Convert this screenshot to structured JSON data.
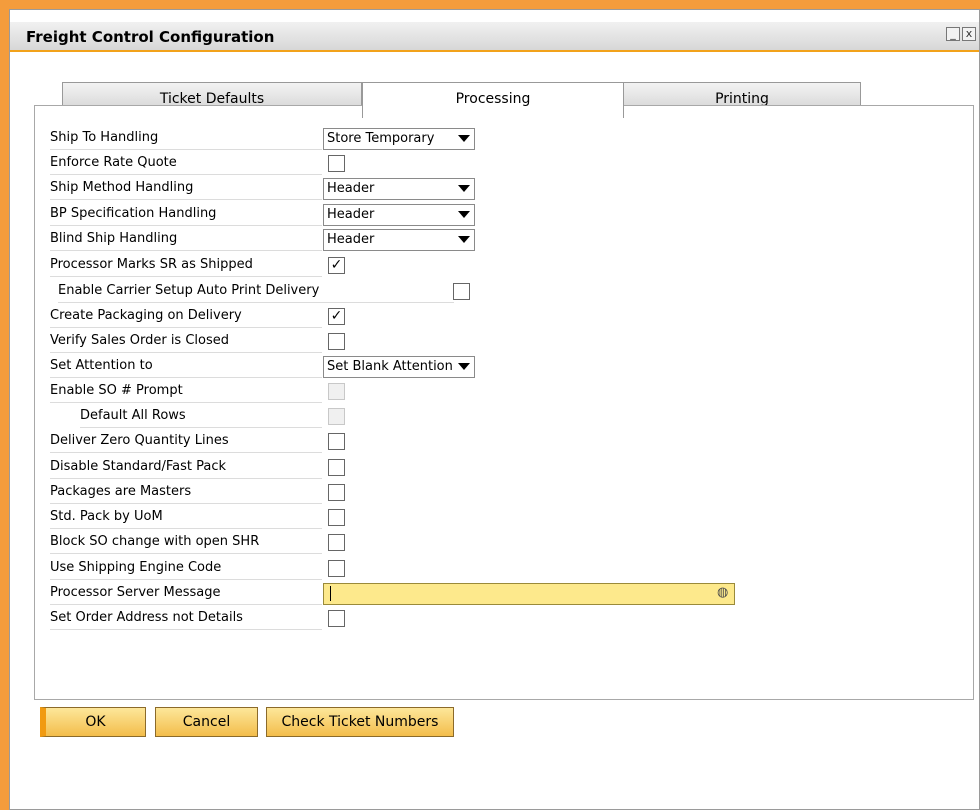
{
  "window": {
    "title": "Freight Control Configuration",
    "minimize": "_",
    "close": "x"
  },
  "tabs": [
    {
      "label": "Ticket Defaults"
    },
    {
      "label": "Processing"
    },
    {
      "label": "Printing"
    }
  ],
  "form": {
    "ship_to_handling": {
      "label": "Ship To Handling",
      "value": "Store Temporary"
    },
    "enforce_rate_quote": {
      "label": "Enforce Rate Quote",
      "checked": ""
    },
    "ship_method_handling": {
      "label": "Ship Method Handling",
      "value": "Header"
    },
    "bp_spec_handling": {
      "label": "BP Specification Handling",
      "value": "Header"
    },
    "blind_ship_handling": {
      "label": "Blind Ship Handling",
      "value": "Header"
    },
    "processor_marks": {
      "label": "Processor Marks SR as Shipped",
      "checked": "✓"
    },
    "enable_carrier": {
      "label": "Enable Carrier Setup Auto Print Delivery",
      "checked": ""
    },
    "create_packaging": {
      "label": "Create Packaging on Delivery",
      "checked": "✓"
    },
    "verify_sales_order": {
      "label": "Verify Sales Order is Closed",
      "checked": ""
    },
    "set_attention": {
      "label": "Set Attention to",
      "value": "Set Blank Attention"
    },
    "enable_so_prompt": {
      "label": "Enable SO # Prompt",
      "checked": ""
    },
    "default_all_rows": {
      "label": "Default All Rows",
      "checked": ""
    },
    "deliver_zero": {
      "label": "Deliver Zero Quantity Lines",
      "checked": ""
    },
    "disable_standard": {
      "label": "Disable Standard/Fast Pack",
      "checked": ""
    },
    "packages_masters": {
      "label": "Packages are Masters",
      "checked": ""
    },
    "std_pack_uom": {
      "label": "Std. Pack by UoM",
      "checked": ""
    },
    "block_so_change": {
      "label": "Block SO change with open SHR",
      "checked": ""
    },
    "use_shipping_engine": {
      "label": "Use Shipping Engine Code",
      "checked": ""
    },
    "processor_server_message": {
      "label": "Processor Server Message",
      "value": ""
    },
    "set_order_address": {
      "label": "Set Order Address not Details",
      "checked": ""
    }
  },
  "buttons": {
    "ok": "OK",
    "cancel": "Cancel",
    "check": "Check Ticket Numbers"
  },
  "colors": {
    "accent": "#f49c3c",
    "button": "#f3bd4b",
    "field_highlight": "#fde98c"
  }
}
